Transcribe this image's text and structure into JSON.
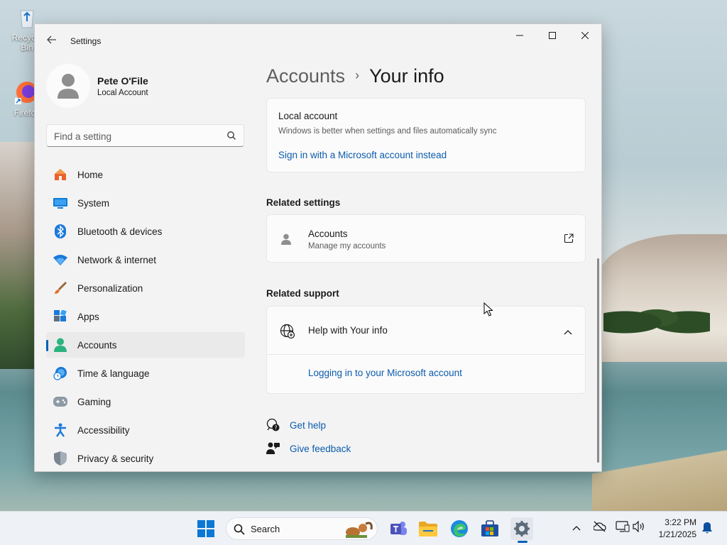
{
  "desktop": {
    "icons": [
      {
        "label": "Recycle Bin"
      },
      {
        "label": "Firefox"
      }
    ]
  },
  "window": {
    "title": "Settings",
    "controls": {
      "minimize": "—",
      "maximize": "☐",
      "close": "✕"
    }
  },
  "profile": {
    "name": "Pete O'File",
    "account_type": "Local Account"
  },
  "search": {
    "placeholder": "Find a setting"
  },
  "nav": {
    "items": [
      {
        "label": "Home",
        "icon": "home-icon"
      },
      {
        "label": "System",
        "icon": "system-icon"
      },
      {
        "label": "Bluetooth & devices",
        "icon": "bluetooth-icon"
      },
      {
        "label": "Network & internet",
        "icon": "wifi-icon"
      },
      {
        "label": "Personalization",
        "icon": "brush-icon"
      },
      {
        "label": "Apps",
        "icon": "apps-icon"
      },
      {
        "label": "Accounts",
        "icon": "accounts-icon",
        "active": true
      },
      {
        "label": "Time & language",
        "icon": "globe-clock-icon"
      },
      {
        "label": "Gaming",
        "icon": "gamepad-icon"
      },
      {
        "label": "Accessibility",
        "icon": "accessibility-icon"
      },
      {
        "label": "Privacy & security",
        "icon": "shield-icon"
      }
    ]
  },
  "breadcrumb": {
    "parent": "Accounts",
    "separator": "›",
    "current": "Your info"
  },
  "local_account_card": {
    "title": "Local account",
    "description": "Windows is better when settings and files automatically sync",
    "link": "Sign in with a Microsoft account instead"
  },
  "related_settings": {
    "title": "Related settings",
    "items": [
      {
        "title": "Accounts",
        "subtitle": "Manage my accounts"
      }
    ]
  },
  "related_support": {
    "title": "Related support",
    "help_title": "Help with Your info",
    "help_link": "Logging in to your Microsoft account"
  },
  "footer_links": {
    "get_help": "Get help",
    "give_feedback": "Give feedback"
  },
  "taskbar": {
    "search_label": "Search",
    "clock_time": "3:22 PM",
    "clock_date": "1/21/2025"
  },
  "colors": {
    "accent": "#005fb8",
    "link": "#0b5cad"
  }
}
